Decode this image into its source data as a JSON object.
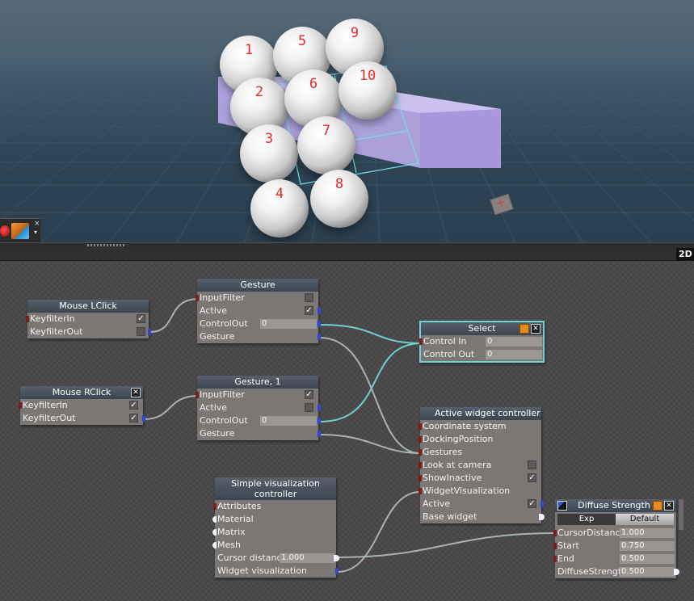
{
  "viewport": {
    "sphere_labels": [
      "1",
      "5",
      "9",
      "2",
      "6",
      "10",
      "3",
      "7",
      "4",
      "8"
    ],
    "marker_glyph": "+",
    "toolbox": {
      "close": "×",
      "arrow": "▾"
    }
  },
  "graph_header": {
    "mode_button": "2D"
  },
  "nodes": {
    "mouse_lclick": {
      "title": "Mouse LClick",
      "rows": [
        {
          "label": "KeyfilterIn",
          "checked": true
        },
        {
          "label": "KeyfilterOut",
          "checked": false
        }
      ]
    },
    "mouse_rclick": {
      "title": "Mouse RClick",
      "close": "✕",
      "rows": [
        {
          "label": "KeyfilterIn",
          "checked": true
        },
        {
          "label": "KeyfilterOut",
          "checked": true
        }
      ]
    },
    "gesture": {
      "title": "Gesture",
      "rows": [
        {
          "label": "InputFilter",
          "checked": false
        },
        {
          "label": "Active",
          "checked": true
        },
        {
          "label": "ControlOut",
          "value": "0"
        },
        {
          "label": "Gesture"
        }
      ]
    },
    "gesture1": {
      "title": "Gesture, 1",
      "rows": [
        {
          "label": "InputFilter",
          "checked": true
        },
        {
          "label": "Active",
          "checked": false
        },
        {
          "label": "ControlOut",
          "value": "0"
        },
        {
          "label": "Gesture"
        }
      ]
    },
    "select": {
      "title": "Select",
      "close": "✕",
      "rows": [
        {
          "label": "Control In",
          "value": "0"
        },
        {
          "label": "Control Out",
          "value": "0"
        }
      ]
    },
    "active_widget": {
      "title": "Active widget controller",
      "rows": [
        {
          "label": "Coordinate system"
        },
        {
          "label": "DockingPosition"
        },
        {
          "label": "Gestures"
        },
        {
          "label": "Look at camera",
          "checked": false
        },
        {
          "label": "ShowInactive",
          "checked": true
        },
        {
          "label": "WidgetVisualization"
        },
        {
          "label": "Active",
          "checked": true
        },
        {
          "label": "Base widget"
        }
      ]
    },
    "simple_vis": {
      "title": "Simple visualization controller",
      "rows": [
        {
          "label": "Attributes"
        },
        {
          "label": "Material"
        },
        {
          "label": "Matrix"
        },
        {
          "label": "Mesh"
        },
        {
          "label": "Cursor distance",
          "value": "1.000"
        },
        {
          "label": "Widget visualization"
        }
      ]
    },
    "diffuse": {
      "title": "Diffuse Strength",
      "close": "✕",
      "tabs": [
        "Exp",
        "Default"
      ],
      "rows": [
        {
          "label": "CursorDistance",
          "value": "1.000"
        },
        {
          "label": "Start",
          "value": "0.750"
        },
        {
          "label": "End",
          "value": "0.500"
        },
        {
          "label": "DiffuseStrength",
          "value": "0.500"
        }
      ]
    }
  },
  "colors": {
    "node_body": "#7b7775",
    "node_title": "#48525d",
    "selected_outline": "#68d6d6",
    "wire_selected": "#6fcfcf",
    "wire_normal": "#a9b4b2",
    "sphere_label": "#e62a2a"
  }
}
